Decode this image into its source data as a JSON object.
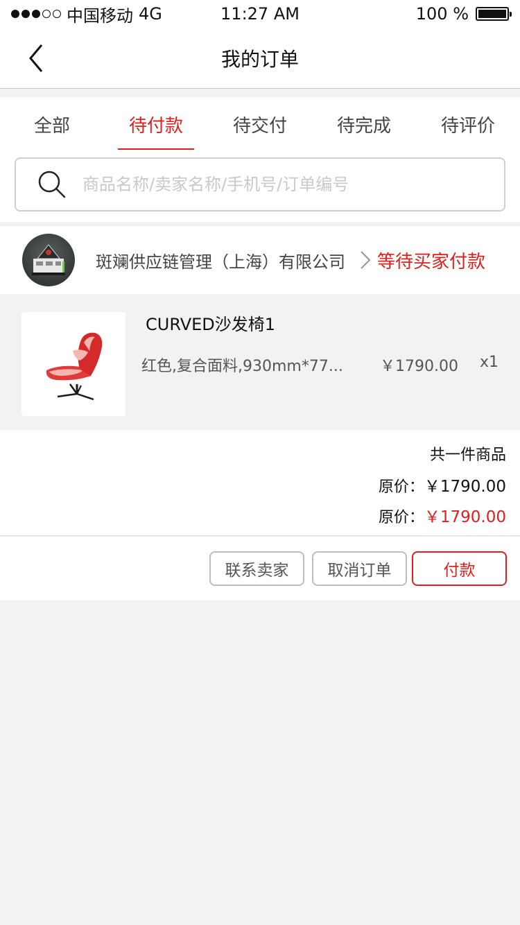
{
  "status_bar": {
    "carrier": "中国移动",
    "network": "4G",
    "time": "11:27 AM",
    "battery": "100 %"
  },
  "nav": {
    "title": "我的订单"
  },
  "tabs": [
    {
      "label": "全部",
      "active": false
    },
    {
      "label": "待付款",
      "active": true
    },
    {
      "label": "待交付",
      "active": false
    },
    {
      "label": "待完成",
      "active": false
    },
    {
      "label": "待评价",
      "active": false
    }
  ],
  "search": {
    "placeholder": "商品名称/卖家名称/手机号/订单编号",
    "value": ""
  },
  "order": {
    "shop_name": "斑斓供应链管理（上海）有限公司",
    "status": "等待买家付款",
    "product": {
      "name": "CURVED沙发椅1",
      "spec": "红色,复合面料,930mm*77...",
      "price": "￥1790.00",
      "qty": "x1"
    },
    "summary": {
      "count_text": "共一件商品",
      "original_label": "原价：",
      "original_amount": "￥1790.00",
      "total_label": "原价：",
      "total_amount": "￥1790.00"
    },
    "actions": {
      "contact": "联系卖家",
      "cancel": "取消订单",
      "pay": "付款"
    }
  },
  "colors": {
    "accent": "#e01e1e",
    "background": "#f2f2f2",
    "border": "#bdbdbd"
  }
}
